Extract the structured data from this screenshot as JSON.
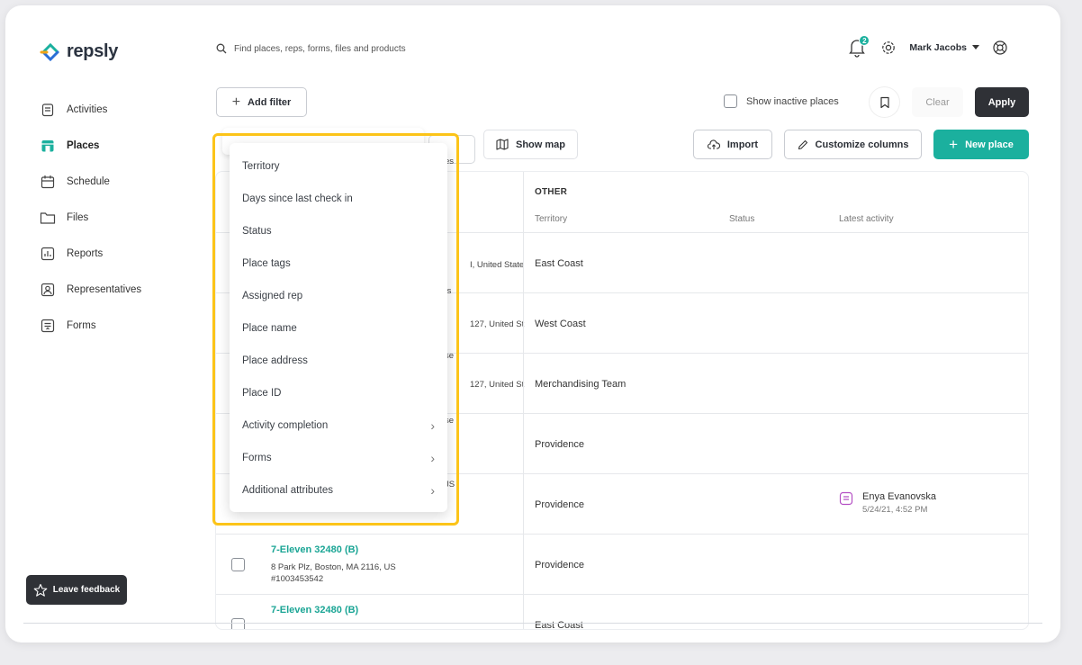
{
  "app": {
    "logo_text": "repsly"
  },
  "search": {
    "placeholder": "Find places, reps, forms, files and products"
  },
  "header": {
    "notification_count": "2",
    "user_name": "Mark Jacobs"
  },
  "sidebar": {
    "items": [
      {
        "label": "Activities",
        "icon": "clipboard-icon"
      },
      {
        "label": "Places",
        "icon": "store-icon"
      },
      {
        "label": "Schedule",
        "icon": "calendar-icon"
      },
      {
        "label": "Files",
        "icon": "folder-icon"
      },
      {
        "label": "Reports",
        "icon": "chart-icon"
      },
      {
        "label": "Representatives",
        "icon": "person-icon"
      },
      {
        "label": "Forms",
        "icon": "form-icon"
      }
    ]
  },
  "toolbar": {
    "add_filter": "Add filter",
    "show_inactive": "Show inactive places",
    "clear": "Clear",
    "apply": "Apply",
    "show_map": "Show map",
    "import": "Import",
    "customize_columns": "Customize columns",
    "new_place": "New place"
  },
  "table": {
    "group_label": "OTHER",
    "columns": {
      "territory": "Territory",
      "status": "Status",
      "latest_activity": "Latest activity"
    },
    "rows": [
      {
        "territory": "East Coast",
        "peek": "I, United State"
      },
      {
        "territory": "West Coast",
        "peek": "127, United St"
      },
      {
        "territory": "Merchandising Team",
        "peek": "127, United St"
      },
      {
        "territory": "Providence",
        "peek": ""
      },
      {
        "territory": "Providence",
        "peek": "",
        "activity_name": "Enya Evanovska",
        "activity_time": "5/24/21, 4:52 PM"
      },
      {
        "territory": "Providence",
        "name": "7-Eleven 32480 (B)",
        "address": "8 Park Plz, Boston, MA 2116, US",
        "id": "#1003453542"
      },
      {
        "territory": "East Coast",
        "name": "7-Eleven 32480 (B)"
      }
    ],
    "peeks": {
      "row0b": "ts",
      "row2b": "se",
      "row3b": "se",
      "row4b": "JS",
      "header": "es"
    }
  },
  "filter_menu": {
    "items": [
      {
        "label": "Territory",
        "has_submenu": false
      },
      {
        "label": "Days since last check in",
        "has_submenu": false
      },
      {
        "label": "Status",
        "has_submenu": false
      },
      {
        "label": "Place tags",
        "has_submenu": false
      },
      {
        "label": "Assigned rep",
        "has_submenu": false
      },
      {
        "label": "Place name",
        "has_submenu": false
      },
      {
        "label": "Place address",
        "has_submenu": false
      },
      {
        "label": "Place ID",
        "has_submenu": false
      },
      {
        "label": "Activity completion",
        "has_submenu": true
      },
      {
        "label": "Forms",
        "has_submenu": true
      },
      {
        "label": "Additional attributes",
        "has_submenu": true
      }
    ]
  },
  "feedback": {
    "label": "Leave feedback"
  },
  "colors": {
    "accent": "#1bb09e",
    "dark": "#2f3136",
    "highlight": "#fcc419"
  }
}
